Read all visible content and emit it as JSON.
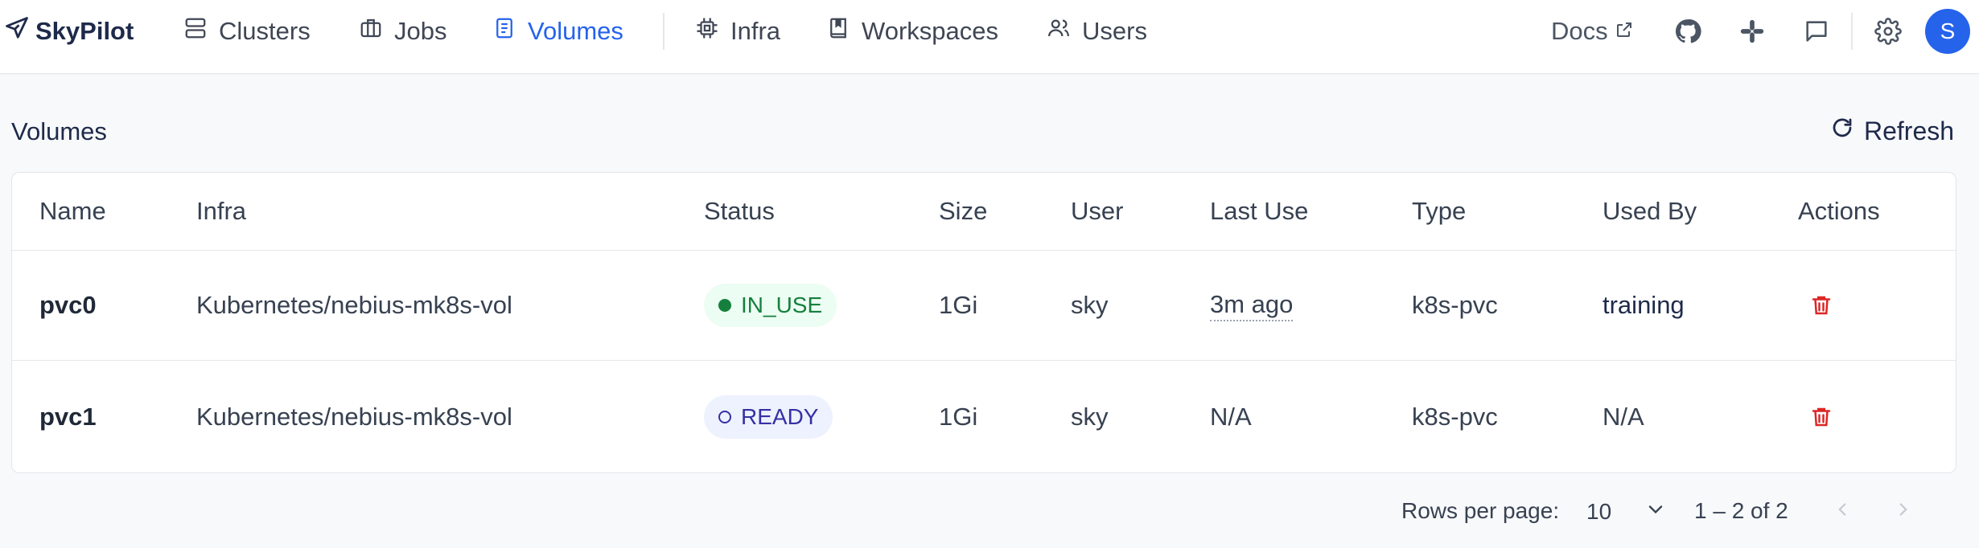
{
  "app": {
    "brand": "SkyPilot"
  },
  "nav": {
    "items": [
      {
        "label": "Clusters",
        "icon": "server-icon"
      },
      {
        "label": "Jobs",
        "icon": "briefcase-icon"
      },
      {
        "label": "Volumes",
        "icon": "book-icon",
        "active": true
      },
      {
        "label": "Infra",
        "icon": "cpu-icon"
      },
      {
        "label": "Workspaces",
        "icon": "notebook-icon"
      },
      {
        "label": "Users",
        "icon": "users-icon"
      }
    ],
    "docs_label": "Docs",
    "avatar_initial": "S"
  },
  "page": {
    "title": "Volumes",
    "refresh_label": "Refresh"
  },
  "table": {
    "headers": {
      "name": "Name",
      "infra": "Infra",
      "status": "Status",
      "size": "Size",
      "user": "User",
      "last_use": "Last Use",
      "type": "Type",
      "used_by": "Used By",
      "actions": "Actions"
    },
    "rows": [
      {
        "name": "pvc0",
        "infra": "Kubernetes/nebius-mk8s-vol",
        "status": "IN_USE",
        "size": "1Gi",
        "user": "sky",
        "last_use": "3m ago",
        "type": "k8s-pvc",
        "used_by": "training"
      },
      {
        "name": "pvc1",
        "infra": "Kubernetes/nebius-mk8s-vol",
        "status": "READY",
        "size": "1Gi",
        "user": "sky",
        "last_use": "N/A",
        "type": "k8s-pvc",
        "used_by": "N/A"
      }
    ]
  },
  "pagination": {
    "rows_per_page_label": "Rows per page:",
    "rows_per_page_value": "10",
    "range_text": "1 – 2 of 2"
  },
  "colors": {
    "accent": "#2563eb",
    "in_use": "#15803d",
    "ready": "#3730a3",
    "danger": "#dc2626"
  }
}
